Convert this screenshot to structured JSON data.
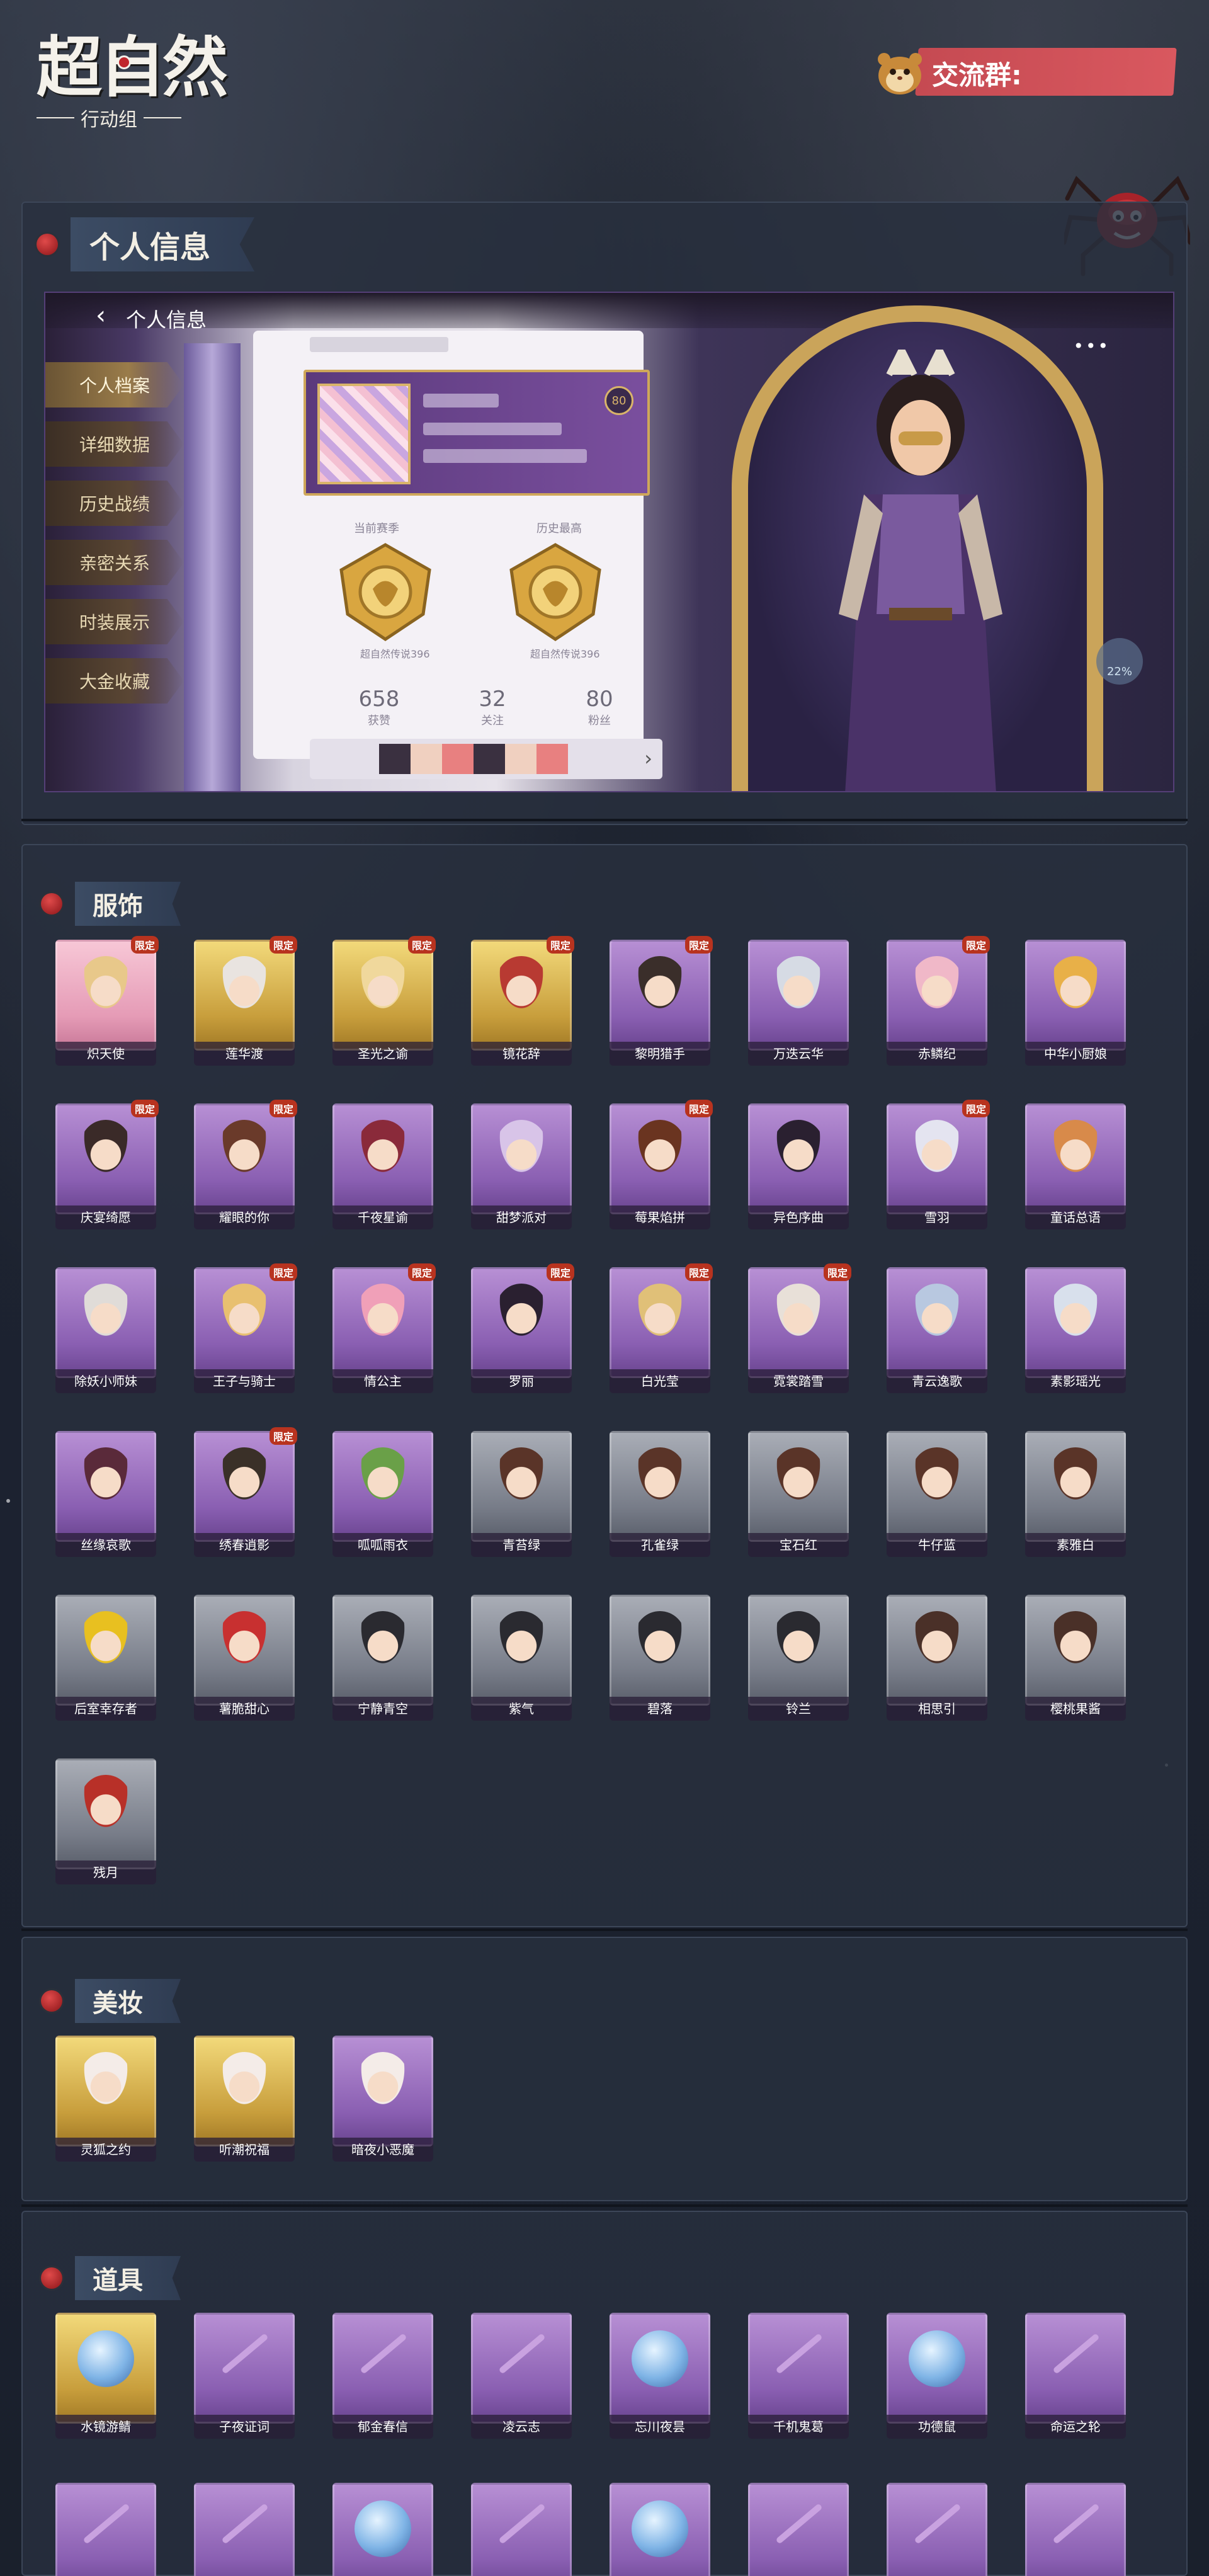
{
  "header": {
    "logo_main": "超自然",
    "logo_sub": "行动组",
    "qq_label": "交流群:"
  },
  "personal": {
    "section_title": "个人信息",
    "game_title": "个人信息",
    "menu": [
      "个人档案",
      "详细数据",
      "历史战绩",
      "亲密关系",
      "时装展示",
      "大金收藏"
    ],
    "active_menu": 0,
    "level": "80",
    "season_current": "当前赛季",
    "season_history": "历史最高",
    "rank_current": "超自然传说396",
    "rank_history": "超自然传说396",
    "stats": [
      {
        "value": "658",
        "label": "获赞"
      },
      {
        "value": "32",
        "label": "关注"
      },
      {
        "value": "80",
        "label": "粉丝"
      }
    ],
    "progress": "22%",
    "more": "•••"
  },
  "costumes": {
    "title": "服饰",
    "items": [
      {
        "name": "炽天使",
        "style": "pink",
        "tag": "限定",
        "hair": "#e8c88a"
      },
      {
        "name": "莲华渡",
        "style": "gold",
        "tag": "限定",
        "hair": "#e9e4e0"
      },
      {
        "name": "圣光之谕",
        "style": "gold",
        "tag": "限定",
        "hair": "#f0d89c"
      },
      {
        "name": "镜花辞",
        "style": "gold",
        "tag": "限定",
        "hair": "#b83a32"
      },
      {
        "name": "黎明猎手",
        "style": "purple",
        "tag": "限定",
        "hair": "#3a2e2a"
      },
      {
        "name": "万迭云华",
        "style": "purple",
        "tag": "",
        "hair": "#d6dbe4"
      },
      {
        "name": "赤鳞纪",
        "style": "purple",
        "tag": "限定",
        "hair": "#f0b8c8"
      },
      {
        "name": "中华小厨娘",
        "style": "purple",
        "tag": "",
        "hair": "#e8b048"
      },
      {
        "name": "庆宴绮愿",
        "style": "purple",
        "tag": "限定",
        "hair": "#3a2a28"
      },
      {
        "name": "耀眼的你",
        "style": "purple",
        "tag": "限定",
        "hair": "#6a3a2a"
      },
      {
        "name": "千夜星谕",
        "style": "purple",
        "tag": "",
        "hair": "#8a2a3a"
      },
      {
        "name": "甜梦派对",
        "style": "purple",
        "tag": "",
        "hair": "#d8c4e8"
      },
      {
        "name": "莓果焰拼",
        "style": "purple",
        "tag": "限定",
        "hair": "#6a3420"
      },
      {
        "name": "异色序曲",
        "style": "purple",
        "tag": "",
        "hair": "#2a2030"
      },
      {
        "name": "雪羽",
        "style": "purple",
        "tag": "限定",
        "hair": "#e4e4f0"
      },
      {
        "name": "童话总语",
        "style": "purple",
        "tag": "",
        "hair": "#d88a4a"
      },
      {
        "name": "除妖小师妹",
        "style": "purple",
        "tag": "",
        "hair": "#e0dcd8"
      },
      {
        "name": "王子与骑士",
        "style": "purple",
        "tag": "限定",
        "hair": "#e8c070"
      },
      {
        "name": "情公主",
        "style": "purple",
        "tag": "限定",
        "hair": "#f0a0b8"
      },
      {
        "name": "罗丽",
        "style": "purple",
        "tag": "限定",
        "hair": "#2a2030"
      },
      {
        "name": "白光莹",
        "style": "purple",
        "tag": "限定",
        "hair": "#e0c078"
      },
      {
        "name": "霓裳踏雪",
        "style": "purple",
        "tag": "限定",
        "hair": "#e8e0d8"
      },
      {
        "name": "青云逸歌",
        "style": "purple",
        "tag": "",
        "hair": "#b8c8e0"
      },
      {
        "name": "素影瑶光",
        "style": "purple",
        "tag": "",
        "hair": "#d8e0ec"
      },
      {
        "name": "丝缘哀歌",
        "style": "purple",
        "tag": "",
        "hair": "#5a2a3a"
      },
      {
        "name": "绣春逍影",
        "style": "purple",
        "tag": "限定",
        "hair": "#3a3028"
      },
      {
        "name": "呱呱雨衣",
        "style": "purple",
        "tag": "",
        "hair": "#6aa048"
      },
      {
        "name": "青苔绿",
        "style": "gray",
        "tag": "",
        "hair": "#5a3428"
      },
      {
        "name": "孔雀绿",
        "style": "gray",
        "tag": "",
        "hair": "#5a3428"
      },
      {
        "name": "宝石红",
        "style": "gray",
        "tag": "",
        "hair": "#5a3428"
      },
      {
        "name": "牛仔蓝",
        "style": "gray",
        "tag": "",
        "hair": "#5a3428"
      },
      {
        "name": "素雅白",
        "style": "gray",
        "tag": "",
        "hair": "#5a3428"
      },
      {
        "name": "后室幸存者",
        "style": "gray",
        "tag": "",
        "hair": "#e8c020"
      },
      {
        "name": "薯脆甜心",
        "style": "gray",
        "tag": "",
        "hair": "#c83030"
      },
      {
        "name": "宁静青空",
        "style": "gray",
        "tag": "",
        "hair": "#2a2a30"
      },
      {
        "name": "紫气",
        "style": "gray",
        "tag": "",
        "hair": "#2a2a30"
      },
      {
        "name": "碧落",
        "style": "gray",
        "tag": "",
        "hair": "#2a2a30"
      },
      {
        "name": "铃兰",
        "style": "gray",
        "tag": "",
        "hair": "#2a2a30"
      },
      {
        "name": "相思引",
        "style": "gray",
        "tag": "",
        "hair": "#4a3028"
      },
      {
        "name": "樱桃果酱",
        "style": "gray",
        "tag": "",
        "hair": "#4a3028"
      },
      {
        "name": "残月",
        "style": "gray",
        "tag": "",
        "hair": "#b83028"
      }
    ]
  },
  "makeup": {
    "title": "美妆",
    "items": [
      {
        "name": "灵狐之约",
        "style": "gold",
        "tag": "",
        "hair": "#f4ece8"
      },
      {
        "name": "听潮祝福",
        "style": "gold",
        "tag": "",
        "hair": "#f4ece8"
      },
      {
        "name": "暗夜小恶魔",
        "style": "purple",
        "tag": "",
        "hair": "#f4ece8"
      }
    ]
  },
  "props": {
    "title": "道具",
    "items": [
      {
        "name": "水镜游鲭",
        "style": "gold",
        "kind": "orb"
      },
      {
        "name": "子夜证词",
        "style": "purple",
        "kind": "stick"
      },
      {
        "name": "郁金春信",
        "style": "purple",
        "kind": "stick"
      },
      {
        "name": "凌云志",
        "style": "purple",
        "kind": "stick"
      },
      {
        "name": "忘川夜昙",
        "style": "purple",
        "kind": "orb"
      },
      {
        "name": "千机鬼葛",
        "style": "purple",
        "kind": "stick"
      },
      {
        "name": "功德鼠",
        "style": "purple",
        "kind": "orb"
      },
      {
        "name": "命运之轮",
        "style": "purple",
        "kind": "stick"
      },
      {
        "name": "",
        "style": "purple",
        "kind": "stick"
      },
      {
        "name": "",
        "style": "purple",
        "kind": "stick"
      },
      {
        "name": "",
        "style": "purple",
        "kind": "orb"
      },
      {
        "name": "",
        "style": "purple",
        "kind": "stick"
      },
      {
        "name": "",
        "style": "purple",
        "kind": "orb"
      },
      {
        "name": "",
        "style": "purple",
        "kind": "stick"
      },
      {
        "name": "",
        "style": "purple",
        "kind": "stick"
      },
      {
        "name": "",
        "style": "purple",
        "kind": "stick"
      }
    ]
  }
}
